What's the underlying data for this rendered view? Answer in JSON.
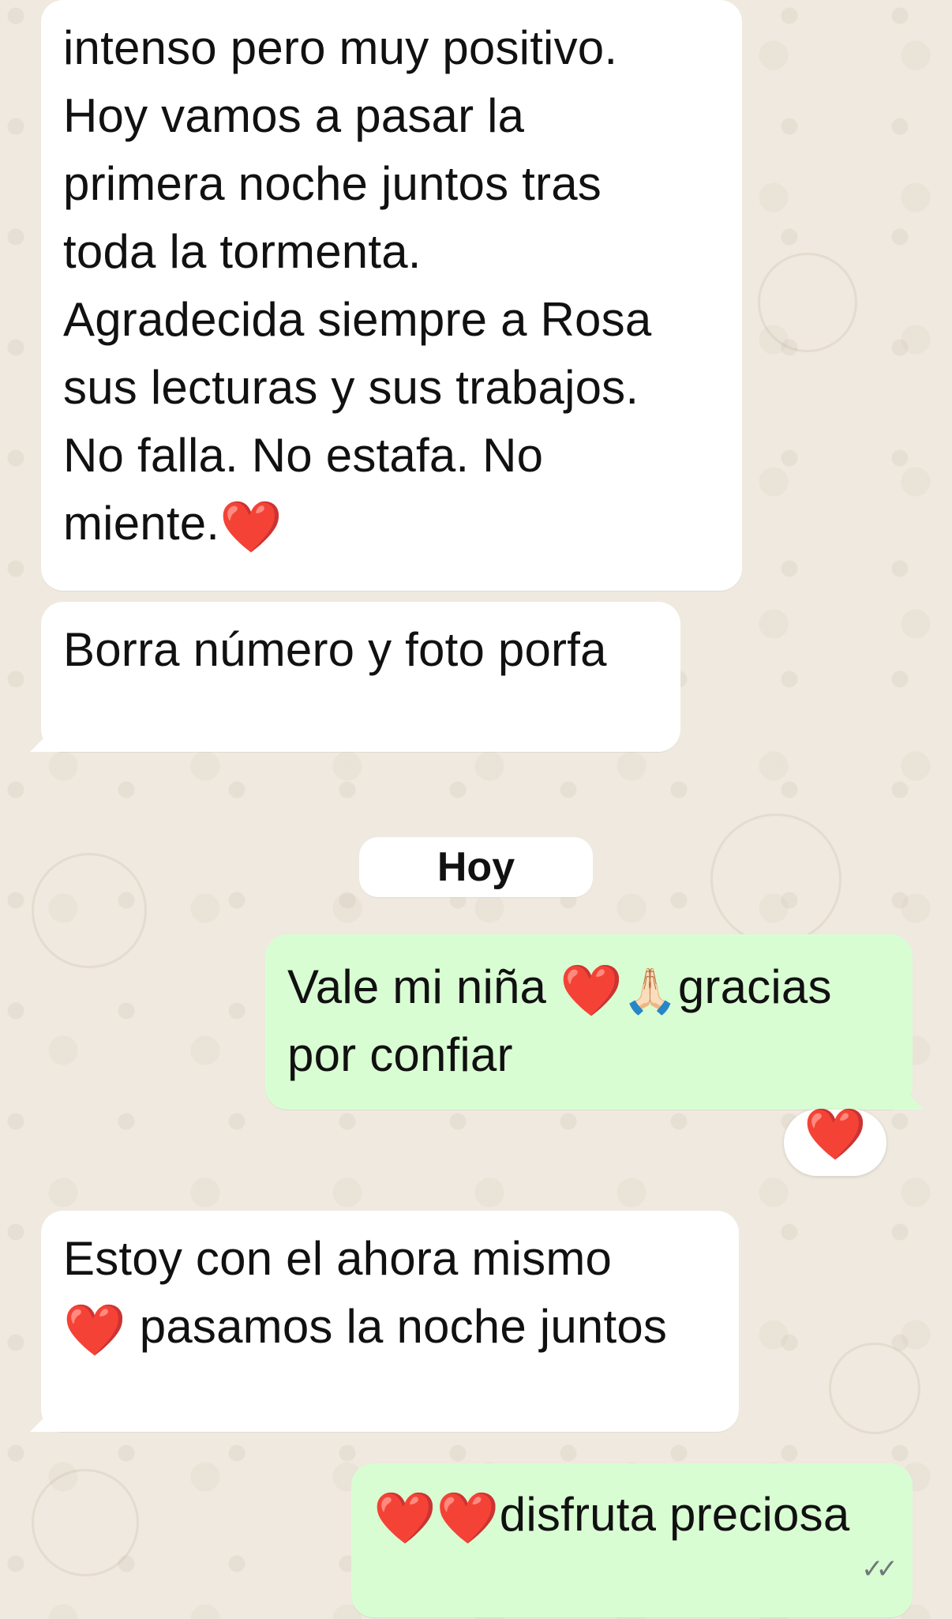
{
  "chat": {
    "messages": [
      {
        "id": "m1",
        "direction": "incoming",
        "lines": [
          "intenso pero muy positivo.",
          "Hoy vamos a pasar la",
          "primera noche juntos tras",
          "toda la tormenta.",
          "Agradecida siempre a Rosa",
          "sus lecturas y sus trabajos.",
          "No falla. No estafa. No",
          "miente."
        ],
        "trailing_emoji": "❤️"
      },
      {
        "id": "m2",
        "direction": "incoming",
        "text": "Borra número y foto porfa"
      },
      {
        "id": "m3",
        "direction": "outgoing",
        "line1_text": "Vale mi niña",
        "line1_emoji_1": "❤️",
        "line1_emoji_2": "🙏🏻",
        "line1_tail": "gracias",
        "line2": "por confiar",
        "reaction": "❤️"
      },
      {
        "id": "m4",
        "direction": "incoming",
        "line1": "Estoy con el ahora mismo",
        "line2_emoji": "❤️",
        "line2_text": " pasamos la noche juntos"
      },
      {
        "id": "m5",
        "direction": "outgoing",
        "emoji_1": "❤️",
        "emoji_2": "❤️",
        "text": "disfruta preciosa",
        "status_icon": "double-check-read"
      }
    ],
    "date_separator": "Hoy"
  },
  "colors": {
    "incoming_bubble": "#ffffff",
    "outgoing_bubble": "#d9fdd3",
    "wallpaper": "#efe9df",
    "heart": "#e21b26"
  }
}
